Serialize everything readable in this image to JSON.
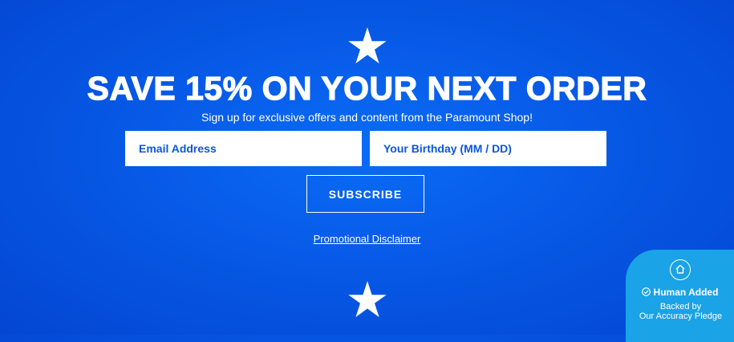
{
  "signup": {
    "headline": "SAVE 15% ON YOUR NEXT ORDER",
    "subtitle": "Sign up for exclusive offers and content from the Paramount Shop!",
    "email_placeholder": "Email Address",
    "birthday_placeholder": "Your Birthday (MM / DD)",
    "subscribe_label": "SUBSCRIBE",
    "disclaimer_link": "Promotional Disclaimer"
  },
  "badge": {
    "title": "Human Added",
    "subtitle_line1": "Backed by",
    "subtitle_line2": "Our Accuracy Pledge"
  },
  "icons": {
    "top": "star-icon",
    "bottom": "star-icon",
    "badge_home": "home-icon",
    "badge_check": "check-circle-icon"
  },
  "colors": {
    "background": "#0759e6",
    "text": "#ffffff",
    "input_text": "#0b56df",
    "badge": "#1aa3e6"
  }
}
